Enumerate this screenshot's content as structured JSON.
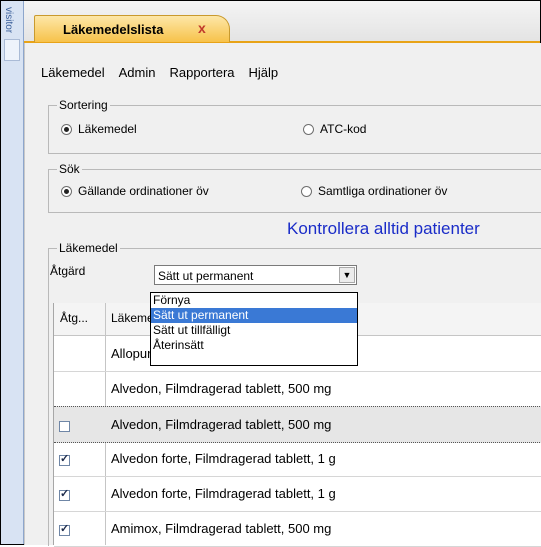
{
  "sidebar": {
    "label": "visitor"
  },
  "tab": {
    "title": "Läkemedelslista",
    "close": "x"
  },
  "menu": [
    "Läkemedel",
    "Admin",
    "Rapportera",
    "Hjälp"
  ],
  "sortering": {
    "title": "Sortering",
    "option1": "Läkemedel",
    "option2": "ATC-kod"
  },
  "sok": {
    "title": "Sök",
    "option1": "Gällande ordinationer öv",
    "option2": "Samtliga ordinationer öv"
  },
  "warning": "Kontrollera alltid patienter",
  "lakemedel": {
    "title": "Läkemedel",
    "atgard_label": "Åtgärd",
    "selected": "Sätt ut permanent",
    "options": [
      "Förnya",
      "Sätt ut permanent",
      "Sätt ut tillfälligt",
      "Återinsätt"
    ]
  },
  "table": {
    "col1": "Åtg...",
    "col2": "Läkemedel",
    "rows": [
      {
        "name": "Allopurinol, Tablett, 100 mg",
        "checked": null
      },
      {
        "name": "Alvedon, Filmdragerad tablett, 500 mg",
        "checked": null
      },
      {
        "name": "Alvedon, Filmdragerad tablett, 500 mg",
        "checked": false
      },
      {
        "name": "Alvedon forte, Filmdragerad tablett, 1 g",
        "checked": true
      },
      {
        "name": "Alvedon forte, Filmdragerad tablett, 1 g",
        "checked": true
      },
      {
        "name": "Amimox, Filmdragerad tablett, 500 mg",
        "checked": true
      }
    ]
  }
}
